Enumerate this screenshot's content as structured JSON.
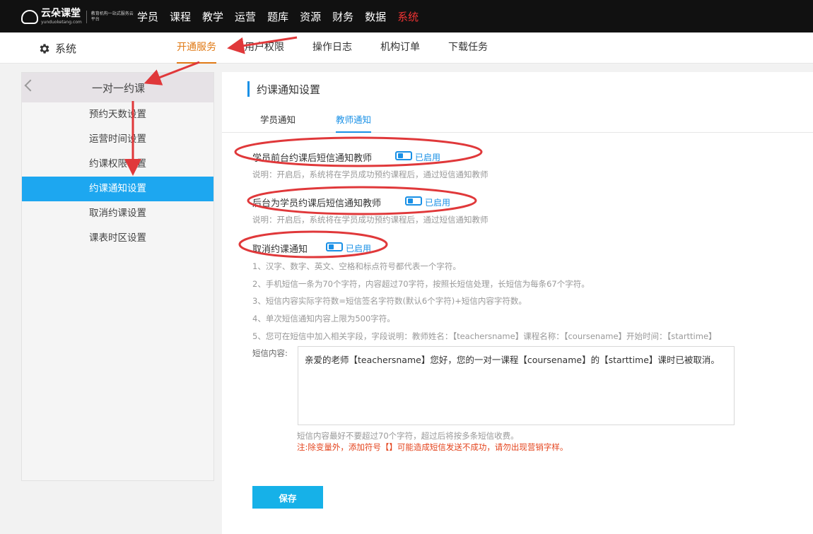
{
  "brand": {
    "name": "云朵课堂",
    "sub": "yunduoketang.com",
    "slogan": "教育机构一站式服务云平台"
  },
  "topnav": [
    "学员",
    "课程",
    "教学",
    "运营",
    "题库",
    "资源",
    "财务",
    "数据",
    "系统"
  ],
  "topnav_active": "系统",
  "system_label": "系统",
  "subtabs": [
    "开通服务",
    "用户权限",
    "操作日志",
    "机构订单",
    "下载任务"
  ],
  "sidebar": {
    "title": "一对一约课",
    "items": [
      "预约天数设置",
      "运营时间设置",
      "约课权限设置",
      "约课通知设置",
      "取消约课设置",
      "课表时区设置"
    ],
    "active": "约课通知设置"
  },
  "main": {
    "title": "约课通知设置",
    "tabs": [
      "学员通知",
      "教师通知"
    ],
    "active_tab": "教师通知",
    "settings": [
      {
        "label": "学员前台约课后短信通知教师",
        "status": "已启用",
        "enabled": true,
        "desc": "说明：开启后，系统将在学员成功预约课程后，通过短信通知教师"
      },
      {
        "label": "后台为学员约课后短信通知教师",
        "status": "已启用",
        "enabled": true,
        "desc": "说明：开启后，系统将在学员成功预约课程后，通过短信通知教师"
      },
      {
        "label": "取消约课通知",
        "status": "已启用",
        "enabled": true
      }
    ],
    "rules": [
      "1、汉字、数字、英文、空格和标点符号都代表一个字符。",
      "2、手机短信一条为70个字符，内容超过70字符，按照长短信处理，长短信为每条67个字符。",
      "3、短信内容实际字符数=短信签名字符数(默认6个字符)+短信内容字符数。",
      "4、单次短信通知内容上限为500字符。",
      "5、您可在短信中加入相关字段，字段说明：教师姓名：【teachersname】课程名称：【coursename】开始时间：【starttime】"
    ],
    "sms_label": "短信内容:",
    "sms_content": "亲爱的老师【teachersname】您好，您的一对一课程【coursename】的【starttime】课时已被取消。",
    "hint": "短信内容最好不要超过70个字符，超过后将按多条短信收费。",
    "warning": "注:除变量外，添加符号【】可能造成短信发送不成功，请勿出现营销字样。",
    "save": "保存"
  },
  "colors": {
    "accent": "#1990e6",
    "active_tab": "#e07a16",
    "sidebar_active": "#1da7f0",
    "save": "#16b1e8",
    "annotation": "#e0383a",
    "warning": "#e4431c"
  }
}
